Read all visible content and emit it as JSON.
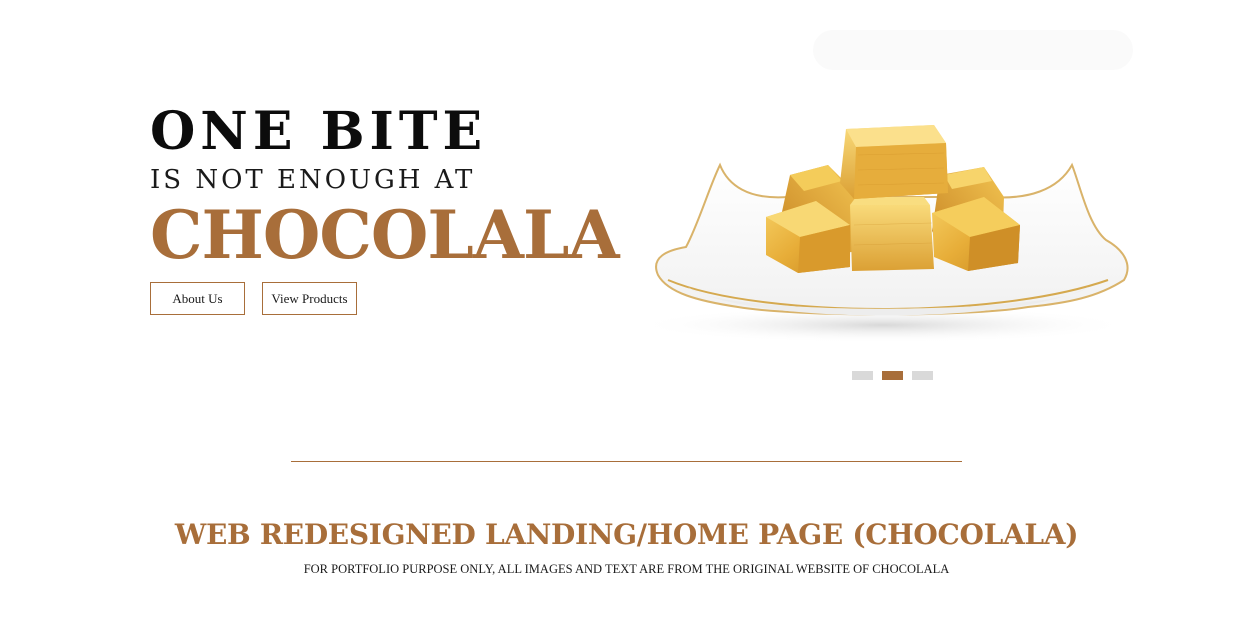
{
  "hero": {
    "line_one": "ONE BITE",
    "line_two": "IS NOT ENOUGH AT",
    "line_three": "CHOCOLALA",
    "buttons": {
      "about_label": "About Us",
      "products_label": "View Products"
    },
    "image": {
      "description_icon": "gold-wrapped-chocolates-plate-icon"
    }
  },
  "carousel": {
    "slide_count": 3,
    "active_index": 1
  },
  "caption": {
    "title": "WEB REDESIGNED LANDING/HOME PAGE (CHOCOLALA)",
    "subtitle": "FOR PORTFOLIO PURPOSE ONLY, ALL IMAGES AND TEXT ARE FROM THE ORIGINAL WEBSITE OF CHOCOLALA"
  },
  "colors": {
    "brand": "#a86e3a",
    "text_dark": "#111111",
    "dot_inactive": "#d9d9d9",
    "gold": "#e5b33f"
  }
}
